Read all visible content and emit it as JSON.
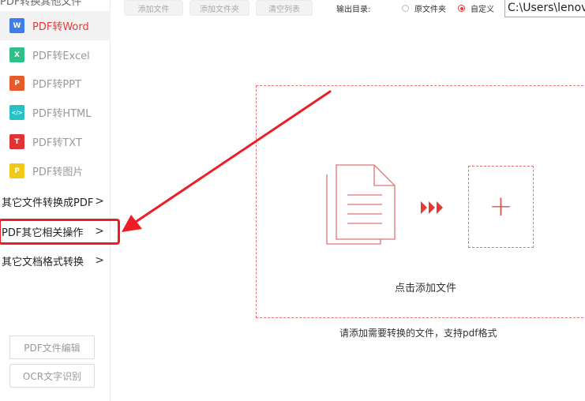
{
  "sidebar": {
    "top_cut": "PDF转换其他文件",
    "items": [
      {
        "label": "PDF转Word",
        "icon": "word-icon",
        "glyph": "W",
        "color": "#3f7ee8",
        "active": true
      },
      {
        "label": "PDF转Excel",
        "icon": "excel-icon",
        "glyph": "X",
        "color": "#2fbf88",
        "active": false
      },
      {
        "label": "PDF转PPT",
        "icon": "ppt-icon",
        "glyph": "P",
        "color": "#e55b2c",
        "active": false
      },
      {
        "label": "PDF转HTML",
        "icon": "html-icon",
        "glyph": "</>",
        "color": "#29c0c6",
        "active": false
      },
      {
        "label": "PDF转TXT",
        "icon": "txt-icon",
        "glyph": "T",
        "color": "#e03434",
        "active": false
      },
      {
        "label": "PDF转图片",
        "icon": "image-icon",
        "glyph": "P",
        "color": "#f2c81b",
        "active": false
      }
    ],
    "groups": [
      {
        "label": "其它文件转换成PDF",
        "chevron": ">"
      },
      {
        "label": "PDF其它相关操作",
        "chevron": ">"
      },
      {
        "label": "其它文档格式转换",
        "chevron": ">"
      }
    ],
    "buttons": {
      "pdf_edit": "PDF文件编辑",
      "ocr": "OCR文字识别"
    }
  },
  "toolbar": {
    "add_file": "添加文件",
    "add_folder": "添加文件夹",
    "clear_list": "清空列表",
    "output_dir_label": "输出目录:",
    "option_original": "原文件夹",
    "option_custom": "自定义",
    "selected_option": "自定义",
    "path_value": "C:\\Users\\lenovo"
  },
  "main": {
    "drop_caption": "点击添加文件",
    "plus": "+",
    "hint": "请添加需要转换的文件，支持pdf格式"
  },
  "colors": {
    "accent": "#e53935",
    "annotation_red": "#ee1c25"
  }
}
